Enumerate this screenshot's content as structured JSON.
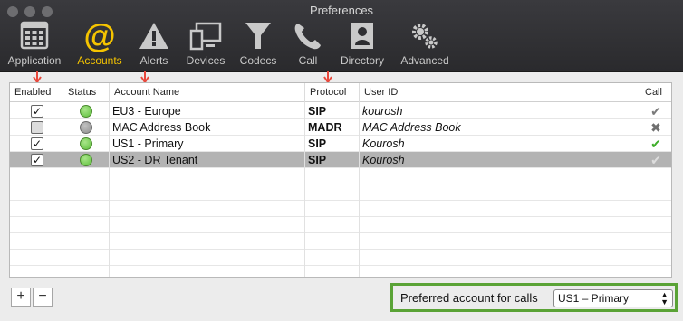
{
  "window": {
    "title": "Preferences"
  },
  "toolbar": {
    "tabs": [
      {
        "label": "Application",
        "icon": "application-grid-icon",
        "selected": false
      },
      {
        "label": "Accounts",
        "icon": "at-sign-icon",
        "selected": true
      },
      {
        "label": "Alerts",
        "icon": "alert-triangle-icon",
        "selected": false
      },
      {
        "label": "Devices",
        "icon": "devices-monitor-icon",
        "selected": false
      },
      {
        "label": "Codecs",
        "icon": "codecs-funnel-icon",
        "selected": false
      },
      {
        "label": "Call",
        "icon": "phone-handset-icon",
        "selected": false
      },
      {
        "label": "Directory",
        "icon": "directory-contact-icon",
        "selected": false
      },
      {
        "label": "Advanced",
        "icon": "advanced-gears-icon",
        "selected": false
      }
    ]
  },
  "table": {
    "columns": {
      "enabled": "Enabled",
      "status": "Status",
      "account_name": "Account Name",
      "protocol": "Protocol",
      "user_id": "User ID",
      "call": "Call"
    },
    "rows": [
      {
        "enabled": true,
        "status": "green",
        "account_name": "EU3 - Europe",
        "protocol": "SIP",
        "user_id": "kourosh",
        "call": "gray-check",
        "selected": false
      },
      {
        "enabled": false,
        "status": "gray",
        "account_name": "MAC Address Book",
        "protocol": "MADR",
        "user_id": "MAC Address Book",
        "call": "x-mark",
        "selected": false
      },
      {
        "enabled": true,
        "status": "green",
        "account_name": "US1 - Primary",
        "protocol": "SIP",
        "user_id": "Kourosh",
        "call": "green-check",
        "selected": false
      },
      {
        "enabled": true,
        "status": "green",
        "account_name": "US2 - DR Tenant",
        "protocol": "SIP",
        "user_id": "Kourosh",
        "call": "gray-check",
        "selected": true
      }
    ]
  },
  "footer": {
    "add_label": "+",
    "remove_label": "−",
    "preferred_label": "Preferred account for calls",
    "preferred_value": "US1 – Primary"
  },
  "colors": {
    "accent_selected_tab": "#f5c400",
    "highlight_border": "#5aa336",
    "annotation_arrow": "#e8483c"
  }
}
